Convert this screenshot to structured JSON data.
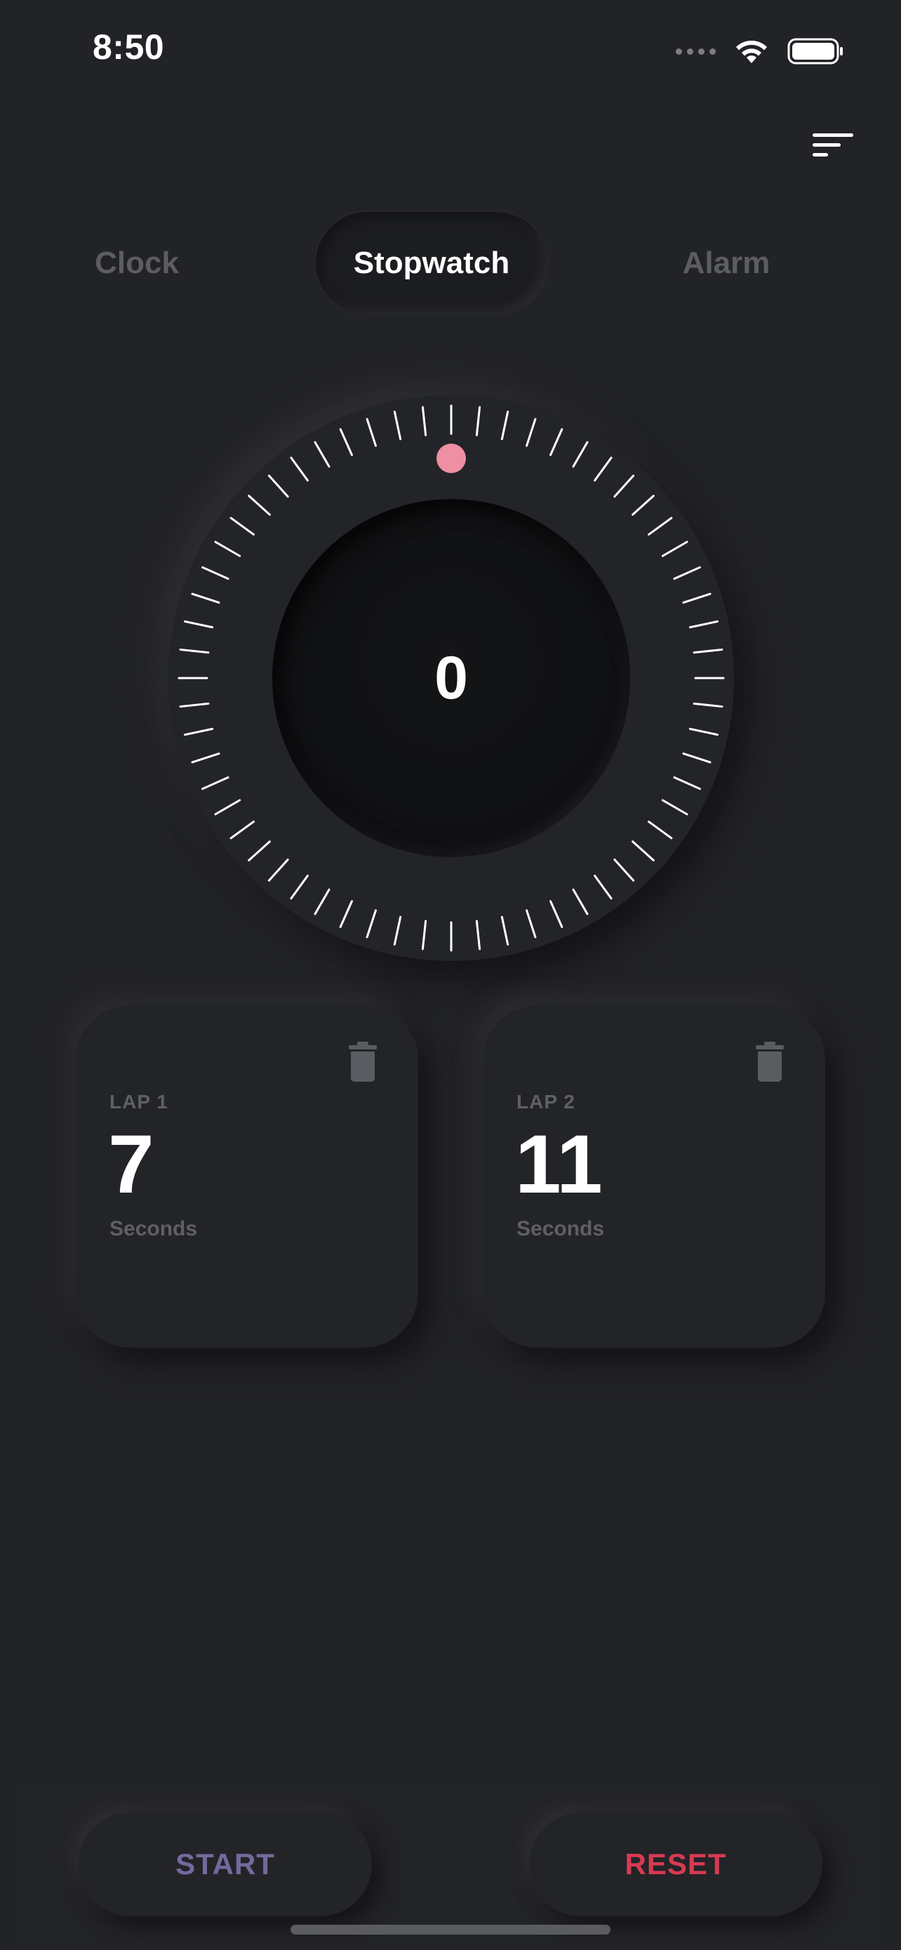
{
  "status_bar": {
    "time": "8:50",
    "icons": [
      "signal-dots-icon",
      "wifi-icon",
      "battery-icon"
    ]
  },
  "header": {
    "menu_icon": "sort-lines-icon"
  },
  "tabs": [
    {
      "label": "Clock",
      "active": false
    },
    {
      "label": "Stopwatch",
      "active": true
    },
    {
      "label": "Alarm",
      "active": false
    }
  ],
  "stopwatch": {
    "value": "0",
    "tick_count": 60,
    "indicator_color": "#ee8fa3",
    "progress": 0
  },
  "laps": [
    {
      "label": "LAP 1",
      "value": "7",
      "unit": "Seconds",
      "delete_icon": "trash-icon"
    },
    {
      "label": "LAP 2",
      "value": "11",
      "unit": "Seconds",
      "delete_icon": "trash-icon"
    }
  ],
  "actions": {
    "start_label": "START",
    "reset_label": "RESET"
  },
  "colors": {
    "background": "#222327",
    "start": "#736a9d",
    "reset": "#d83a52",
    "muted_text": "#5f6065"
  }
}
